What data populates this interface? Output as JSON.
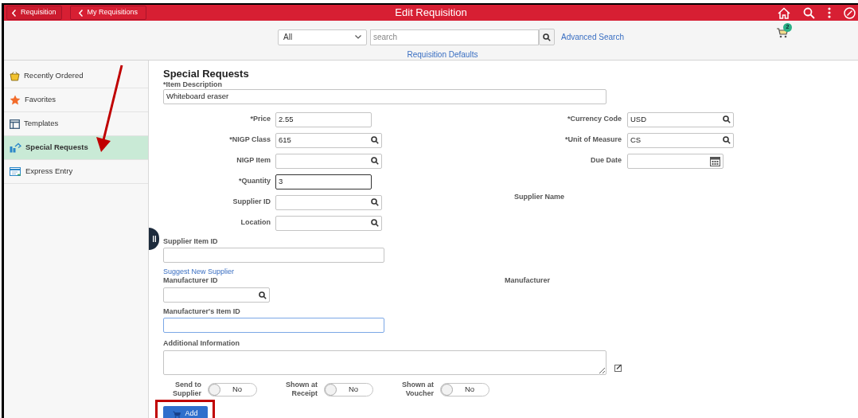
{
  "header": {
    "back_buttons": [
      "Requisition",
      "My Requisitions"
    ],
    "title": "Edit Requisition"
  },
  "toolbar": {
    "scope": "All",
    "search_placeholder": "search",
    "advanced_search": "Advanced Search",
    "defaults_link": "Requisition Defaults",
    "cart_count": "2"
  },
  "sidebar": {
    "items": [
      {
        "label": "Recently Ordered",
        "kind": "basket",
        "selected": false
      },
      {
        "label": "Favorites",
        "kind": "star",
        "selected": false
      },
      {
        "label": "Templates",
        "kind": "template",
        "selected": false
      },
      {
        "label": "Special Requests",
        "kind": "special",
        "selected": true
      },
      {
        "label": "Express Entry",
        "kind": "express",
        "selected": false
      }
    ]
  },
  "form": {
    "title": "Special Requests",
    "item_description": {
      "label": "*Item Description",
      "value": "Whiteboard eraser"
    },
    "left_fields": [
      {
        "label": "*Price",
        "value": "2.55",
        "kind": "text",
        "focused": false
      },
      {
        "label": "*NIGP Class",
        "value": "615",
        "kind": "lookup",
        "focused": false
      },
      {
        "label": "NIGP Item",
        "kind": "lookup",
        "focused": false
      },
      {
        "label": "*Quantity",
        "value": "3",
        "kind": "text",
        "focused": true
      },
      {
        "label": "Supplier ID",
        "kind": "lookup",
        "focused": false
      },
      {
        "label": "Location",
        "kind": "lookup",
        "focused": false
      }
    ],
    "right_fields": [
      {
        "label": "*Currency Code",
        "value": "USD",
        "kind": "lookup"
      },
      {
        "label": "*Unit of Measure",
        "value": "CS",
        "kind": "lookup"
      },
      {
        "label": "Due Date",
        "kind": "date"
      }
    ],
    "supplier_name_label": "Supplier Name",
    "supplier_item_id": {
      "label": "Supplier Item ID",
      "focused": false
    },
    "suggest_new_supplier": "Suggest New Supplier",
    "manufacturer_id": {
      "label": "Manufacturer ID"
    },
    "manufacturer_label": "Manufacturer",
    "manufacturer_item_id": {
      "label": "Manufacturer's Item ID",
      "focused": true
    },
    "additional_information": {
      "label": "Additional Information"
    },
    "toggles": [
      {
        "label": "Send to Supplier",
        "on": false,
        "text": "No"
      },
      {
        "label": "Shown at Receipt",
        "on": false,
        "text": "No"
      },
      {
        "label": "Shown at Voucher",
        "on": false,
        "text": "No"
      }
    ],
    "add_button": "Add"
  }
}
